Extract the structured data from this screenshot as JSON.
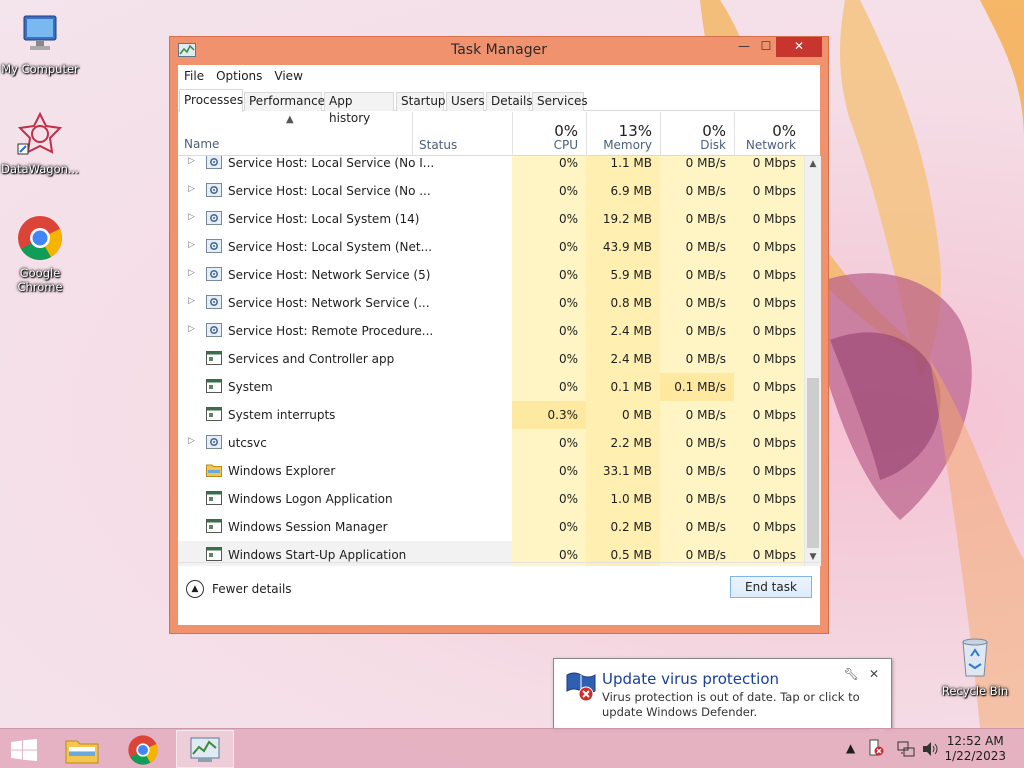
{
  "desktop": {
    "icons": [
      {
        "label": "My Computer"
      },
      {
        "label": "DataWagon..."
      },
      {
        "label": "Google Chrome"
      },
      {
        "label": "Recycle Bin"
      }
    ]
  },
  "window": {
    "title": "Task Manager",
    "minimize": "—",
    "maximize": "☐",
    "close": "✕",
    "menu": [
      "File",
      "Options",
      "View"
    ],
    "tabs": [
      "Processes",
      "Performance",
      "App history",
      "Startup",
      "Users",
      "Details",
      "Services"
    ],
    "active_tab": "Processes",
    "columns": {
      "name": "Name",
      "status": "Status",
      "cpu": {
        "label": "CPU",
        "pct": "0%"
      },
      "memory": {
        "label": "Memory",
        "pct": "13%"
      },
      "disk": {
        "label": "Disk",
        "pct": "0%"
      },
      "network": {
        "label": "Network",
        "pct": "0%"
      }
    },
    "rows": [
      {
        "name": "Service Host: Local Service (No I...",
        "expand": true,
        "icon": "gear-icon",
        "cpu": "0%",
        "memory": "1.1 MB",
        "disk": "0 MB/s",
        "network": "0 Mbps"
      },
      {
        "name": "Service Host: Local Service (No ...",
        "expand": true,
        "icon": "gear-icon",
        "cpu": "0%",
        "memory": "6.9 MB",
        "disk": "0 MB/s",
        "network": "0 Mbps"
      },
      {
        "name": "Service Host: Local System (14)",
        "expand": true,
        "icon": "gear-icon",
        "cpu": "0%",
        "memory": "19.2 MB",
        "disk": "0 MB/s",
        "network": "0 Mbps"
      },
      {
        "name": "Service Host: Local System (Net...",
        "expand": true,
        "icon": "gear-icon",
        "cpu": "0%",
        "memory": "43.9 MB",
        "disk": "0 MB/s",
        "network": "0 Mbps"
      },
      {
        "name": "Service Host: Network Service (5)",
        "expand": true,
        "icon": "gear-icon",
        "cpu": "0%",
        "memory": "5.9 MB",
        "disk": "0 MB/s",
        "network": "0 Mbps"
      },
      {
        "name": "Service Host: Network Service (...",
        "expand": true,
        "icon": "gear-icon",
        "cpu": "0%",
        "memory": "0.8 MB",
        "disk": "0 MB/s",
        "network": "0 Mbps"
      },
      {
        "name": "Service Host: Remote Procedure...",
        "expand": true,
        "icon": "gear-icon",
        "cpu": "0%",
        "memory": "2.4 MB",
        "disk": "0 MB/s",
        "network": "0 Mbps"
      },
      {
        "name": "Services and Controller app",
        "expand": false,
        "icon": "app-window-icon",
        "cpu": "0%",
        "memory": "2.4 MB",
        "disk": "0 MB/s",
        "network": "0 Mbps"
      },
      {
        "name": "System",
        "expand": false,
        "icon": "app-window-icon",
        "cpu": "0%",
        "memory": "0.1 MB",
        "disk": "0.1 MB/s",
        "network": "0 Mbps"
      },
      {
        "name": "System interrupts",
        "expand": false,
        "icon": "app-window-icon",
        "cpu": "0.3%",
        "memory": "0 MB",
        "disk": "0 MB/s",
        "network": "0 Mbps"
      },
      {
        "name": "utcsvc",
        "expand": true,
        "icon": "gear-icon",
        "cpu": "0%",
        "memory": "2.2 MB",
        "disk": "0 MB/s",
        "network": "0 Mbps"
      },
      {
        "name": "Windows Explorer",
        "expand": false,
        "icon": "folder-icon",
        "cpu": "0%",
        "memory": "33.1 MB",
        "disk": "0 MB/s",
        "network": "0 Mbps"
      },
      {
        "name": "Windows Logon Application",
        "expand": false,
        "icon": "app-window-icon",
        "cpu": "0%",
        "memory": "1.0 MB",
        "disk": "0 MB/s",
        "network": "0 Mbps"
      },
      {
        "name": "Windows Session Manager",
        "expand": false,
        "icon": "app-window-icon",
        "cpu": "0%",
        "memory": "0.2 MB",
        "disk": "0 MB/s",
        "network": "0 Mbps"
      },
      {
        "name": "Windows Start-Up Application",
        "expand": false,
        "icon": "app-window-icon",
        "cpu": "0%",
        "memory": "0.5 MB",
        "disk": "0 MB/s",
        "network": "0 Mbps"
      }
    ],
    "fewer_details": "Fewer details",
    "end_task": "End task"
  },
  "notification": {
    "title": "Update virus protection",
    "body": "Virus protection is out of date. Tap or click to update Windows Defender.",
    "icon": "defender-warning-icon"
  },
  "taskbar": {
    "time": "12:52 AM",
    "date": "1/22/2023"
  },
  "colors": {
    "window_frame": "#f0926e",
    "close_button": "#c7362e",
    "cpu_highlight": "#fff4c4",
    "memory_highlight": "#ffefb0",
    "accent_blue": "#1a3f96"
  }
}
